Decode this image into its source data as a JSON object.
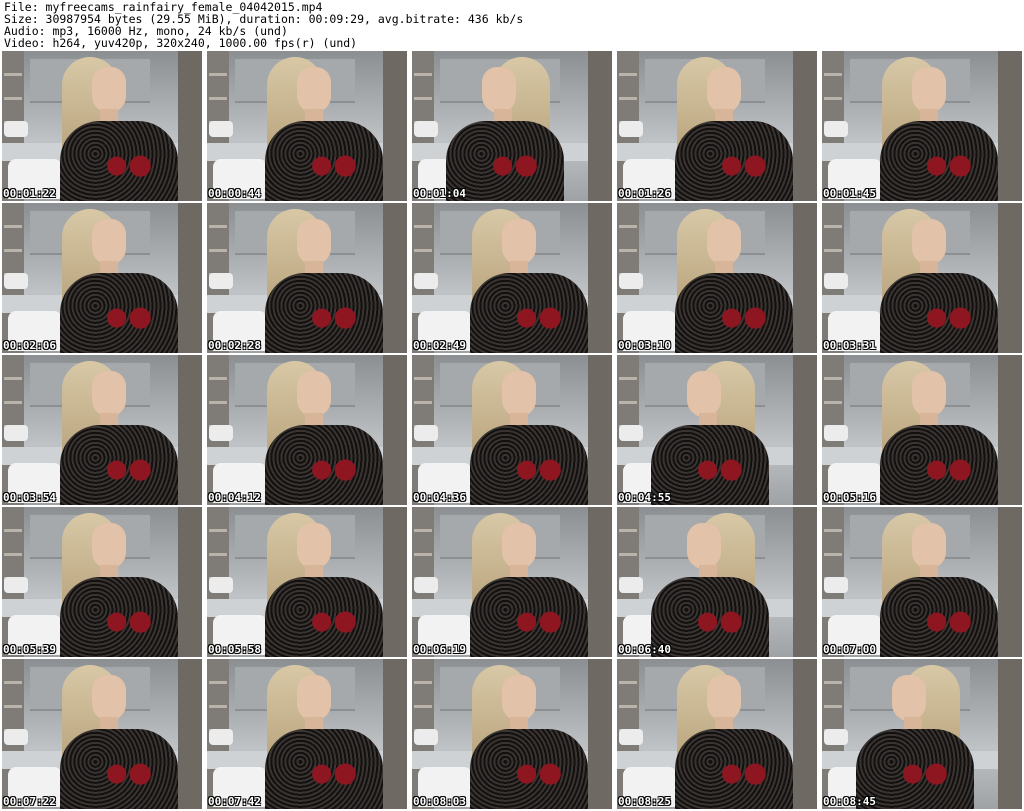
{
  "header": {
    "file_line": "File: myfreecams_rainfairy_female_04042015.mp4",
    "size_line": "Size: 30987954 bytes (29.55 MiB), duration: 00:09:29, avg.bitrate: 436 kb/s",
    "audio_line": "Audio: mp3, 16000 Hz, mono, 24 kb/s (und)",
    "video_line": "Video: h264, yuv420p, 320x240, 1000.00 fps(r) (und)"
  },
  "thumbnails": [
    {
      "timestamp": "00:01:22"
    },
    {
      "timestamp": "00:00:44"
    },
    {
      "timestamp": "00:01:04"
    },
    {
      "timestamp": "00:01:26"
    },
    {
      "timestamp": "00:01:45"
    },
    {
      "timestamp": "00:02:06"
    },
    {
      "timestamp": "00:02:28"
    },
    {
      "timestamp": "00:02:49"
    },
    {
      "timestamp": "00:03:10"
    },
    {
      "timestamp": "00:03:31"
    },
    {
      "timestamp": "00:03:54"
    },
    {
      "timestamp": "00:04:12"
    },
    {
      "timestamp": "00:04:36"
    },
    {
      "timestamp": "00:04:55"
    },
    {
      "timestamp": "00:05:16"
    },
    {
      "timestamp": "00:05:39"
    },
    {
      "timestamp": "00:05:58"
    },
    {
      "timestamp": "00:06:19"
    },
    {
      "timestamp": "00:06:40"
    },
    {
      "timestamp": "00:07:00"
    },
    {
      "timestamp": "00:07:22"
    },
    {
      "timestamp": "00:07:42"
    },
    {
      "timestamp": "00:08:03"
    },
    {
      "timestamp": "00:08:25"
    },
    {
      "timestamp": "00:08:45"
    }
  ]
}
